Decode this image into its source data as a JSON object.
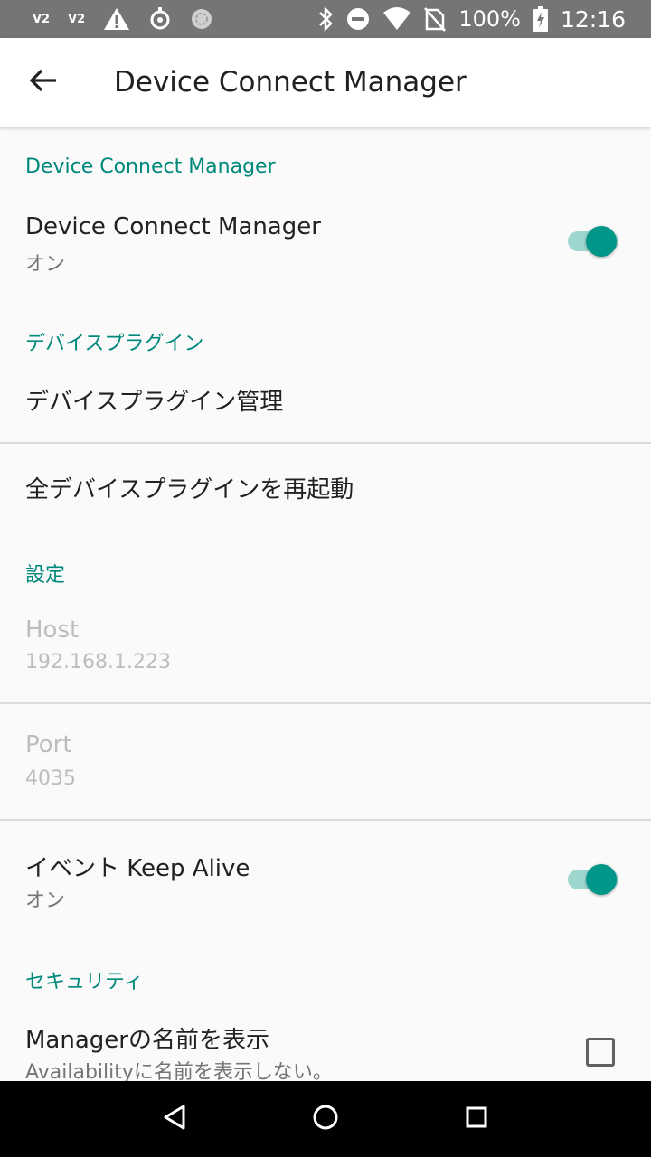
{
  "status_bar": {
    "left_badges": [
      "V2",
      "V2"
    ],
    "battery": "100%",
    "time": "12:16",
    "icons": [
      "warning-icon",
      "usb-debug-icon",
      "sync-icon",
      "bluetooth-icon",
      "do-not-disturb-icon",
      "wifi-icon",
      "no-sim-icon",
      "battery-charging-icon"
    ]
  },
  "app_bar": {
    "title": "Device Connect Manager"
  },
  "sections": {
    "manager": {
      "header": "Device Connect Manager",
      "toggle_title": "Device Connect Manager",
      "toggle_summary": "オン",
      "toggle_on": true
    },
    "plugins": {
      "header": "デバイスプラグイン",
      "manage_title": "デバイスプラグイン管理",
      "restart_title": "全デバイスプラグインを再起動"
    },
    "settings": {
      "header": "設定",
      "host_title": "Host",
      "host_value": "192.168.1.223",
      "port_title": "Port",
      "port_value": "4035",
      "keepalive_title": "イベント Keep Alive",
      "keepalive_summary": "オン",
      "keepalive_on": true
    },
    "security": {
      "header": "セキュリティ",
      "show_name_title": "Managerの名前を表示",
      "show_name_summary": "Availabilityに名前を表示しない。",
      "show_name_checked": false
    }
  },
  "colors": {
    "accent": "#00897b",
    "switch_thumb": "#00968a",
    "switch_track": "#9ed6d0",
    "status_bar": "#757575",
    "background": "#fafafa"
  }
}
